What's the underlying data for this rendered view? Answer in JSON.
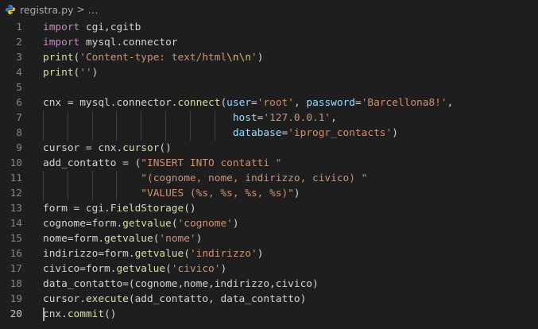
{
  "breadcrumb": {
    "file_icon": "python-file-icon",
    "file_name": "registra.py",
    "separator": ">",
    "more": "..."
  },
  "colors": {
    "background": "#1e1e1e",
    "keyword": "#c586c0",
    "function": "#dcdcaa",
    "string": "#ce9178",
    "escape": "#d7ba7d",
    "parameter": "#9cdcfe",
    "text": "#d4d4d4",
    "line_number": "#858585"
  },
  "editor": {
    "current_line": 20,
    "lines": [
      {
        "n": "1",
        "tokens": [
          [
            "kw",
            "import"
          ],
          [
            "t",
            " cgi,cgitb"
          ]
        ]
      },
      {
        "n": "2",
        "tokens": [
          [
            "kw",
            "import"
          ],
          [
            "t",
            " mysql.connector"
          ]
        ]
      },
      {
        "n": "3",
        "tokens": [
          [
            "fn",
            "print"
          ],
          [
            "t",
            "("
          ],
          [
            "str",
            "'Content-type: text/html"
          ],
          [
            "esc",
            "\\n\\n"
          ],
          [
            "str",
            "'"
          ],
          [
            "t",
            ")"
          ]
        ]
      },
      {
        "n": "4",
        "tokens": [
          [
            "fn",
            "print"
          ],
          [
            "t",
            "("
          ],
          [
            "str",
            "''"
          ],
          [
            "t",
            ")"
          ]
        ]
      },
      {
        "n": "5",
        "tokens": []
      },
      {
        "n": "6",
        "tokens": [
          [
            "t",
            "cnx = mysql.connector."
          ],
          [
            "fn",
            "connect"
          ],
          [
            "t",
            "("
          ],
          [
            "param",
            "user"
          ],
          [
            "t",
            "="
          ],
          [
            "str",
            "'root'"
          ],
          [
            "t",
            ", "
          ],
          [
            "param",
            "password"
          ],
          [
            "t",
            "="
          ],
          [
            "str",
            "'Barcellona8!'"
          ],
          [
            "t",
            ","
          ]
        ]
      },
      {
        "n": "7",
        "tokens": [
          [
            "t",
            "                               "
          ],
          [
            "param",
            "host"
          ],
          [
            "t",
            "="
          ],
          [
            "str",
            "'127.0.0.1'"
          ],
          [
            "t",
            ","
          ]
        ]
      },
      {
        "n": "8",
        "tokens": [
          [
            "t",
            "                               "
          ],
          [
            "param",
            "database"
          ],
          [
            "t",
            "="
          ],
          [
            "str",
            "'iprogr_contacts'"
          ],
          [
            "t",
            ")"
          ]
        ]
      },
      {
        "n": "9",
        "tokens": [
          [
            "t",
            "cursor = cnx."
          ],
          [
            "fn",
            "cursor"
          ],
          [
            "t",
            "()"
          ]
        ]
      },
      {
        "n": "10",
        "tokens": [
          [
            "t",
            "add_contatto = ("
          ],
          [
            "str",
            "\"INSERT INTO contatti \""
          ]
        ]
      },
      {
        "n": "11",
        "tokens": [
          [
            "t",
            "                "
          ],
          [
            "str",
            "\"(cognome, nome, indirizzo, civico) \""
          ]
        ]
      },
      {
        "n": "12",
        "tokens": [
          [
            "t",
            "                "
          ],
          [
            "str",
            "\"VALUES (%s, %s, %s, %s)\""
          ],
          [
            "t",
            ")"
          ]
        ]
      },
      {
        "n": "13",
        "tokens": [
          [
            "t",
            "form = cgi."
          ],
          [
            "fn",
            "FieldStorage"
          ],
          [
            "t",
            "()"
          ]
        ]
      },
      {
        "n": "14",
        "tokens": [
          [
            "t",
            "cognome=form."
          ],
          [
            "fn",
            "getvalue"
          ],
          [
            "t",
            "("
          ],
          [
            "str",
            "'cognome'"
          ],
          [
            "t",
            ")"
          ]
        ]
      },
      {
        "n": "15",
        "tokens": [
          [
            "t",
            "nome=form."
          ],
          [
            "fn",
            "getvalue"
          ],
          [
            "t",
            "("
          ],
          [
            "str",
            "'nome'"
          ],
          [
            "t",
            ")"
          ]
        ]
      },
      {
        "n": "16",
        "tokens": [
          [
            "t",
            "indirizzo=form."
          ],
          [
            "fn",
            "getvalue"
          ],
          [
            "t",
            "("
          ],
          [
            "str",
            "'indirizzo'"
          ],
          [
            "t",
            ")"
          ]
        ]
      },
      {
        "n": "17",
        "tokens": [
          [
            "t",
            "civico=form."
          ],
          [
            "fn",
            "getvalue"
          ],
          [
            "t",
            "("
          ],
          [
            "str",
            "'civico'"
          ],
          [
            "t",
            ")"
          ]
        ]
      },
      {
        "n": "18",
        "tokens": [
          [
            "t",
            "data_contatto=(cognome,nome,indirizzo,civico)"
          ]
        ]
      },
      {
        "n": "19",
        "tokens": [
          [
            "t",
            "cursor."
          ],
          [
            "fn",
            "execute"
          ],
          [
            "t",
            "(add_contatto, data_contatto)"
          ]
        ]
      },
      {
        "n": "20",
        "tokens": [
          [
            "t",
            "cnx."
          ],
          [
            "fn",
            "commit"
          ],
          [
            "t",
            "()"
          ]
        ]
      }
    ]
  }
}
